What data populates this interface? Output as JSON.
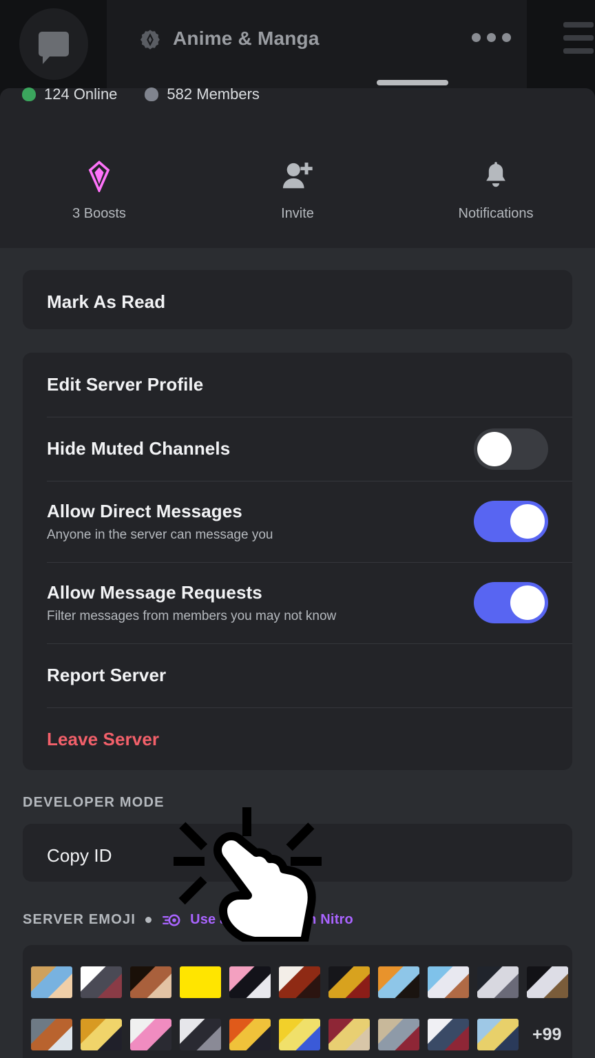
{
  "window": {
    "background_color": "#2b2d31",
    "card_color": "#232428",
    "accent_blurple": "#5865F2",
    "danger_color": "#f2606a",
    "nitro_color": "#a964ff",
    "boost_color": "#ff73fa"
  },
  "chrome": {
    "chat_icon": "chat-bubble-icon",
    "server_badge_icon": "server-verified-badge-icon",
    "title": "Anime & Manga",
    "overflow_icon": "more-options-icon",
    "drag_handle": "sheet-drag-handle",
    "hamburger_icon": "hamburger-menu-icon"
  },
  "counts": {
    "online": "124 Online",
    "members": "582 Members",
    "online_dot_color": "#3ba55d",
    "members_dot_color": "#80848e"
  },
  "actions": [
    {
      "label": "3 Boosts",
      "icon": "boost-gem-icon"
    },
    {
      "label": "Invite",
      "icon": "person-add-icon"
    },
    {
      "label": "Notifications",
      "icon": "bell-icon"
    }
  ],
  "mark_as_read": {
    "label": "Mark As Read"
  },
  "settings_rows": [
    {
      "title": "Edit Server Profile",
      "subtitle": "",
      "control": "none",
      "danger": false
    },
    {
      "title": "Hide Muted Channels",
      "subtitle": "",
      "control": "toggle-off",
      "danger": false
    },
    {
      "title": "Allow Direct Messages",
      "subtitle": "Anyone in the server can message you",
      "control": "toggle-on",
      "danger": false
    },
    {
      "title": "Allow Message Requests",
      "subtitle": "Filter messages from members you may not know",
      "control": "toggle-on",
      "danger": false
    },
    {
      "title": "Report Server",
      "subtitle": "",
      "control": "none",
      "danger": false
    },
    {
      "title": "Leave Server",
      "subtitle": "",
      "control": "none",
      "danger": true
    }
  ],
  "developer_mode": {
    "section_label": "DEVELOPER MODE",
    "copy_id_label": "Copy ID"
  },
  "server_emoji": {
    "section_label": "SERVER EMOJI",
    "nitro_icon": "nitro-boost-icon",
    "nitro_label": "Use anywhere with Nitro",
    "more_count": "+99",
    "row1": [
      {
        "name": "naruto-squint-emoji",
        "c1": "#cfa15c",
        "c2": "#78b2e0",
        "c3": "#f0cfa8"
      },
      {
        "name": "itachi-facepalm-emoji",
        "c1": "#ffffff",
        "c2": "#4a4a55",
        "c3": "#8a3b46"
      },
      {
        "name": "dark-scream-emoji",
        "c1": "#1a1008",
        "c2": "#a9603c",
        "c3": "#e3c3a4"
      },
      {
        "name": "koro-sensei-grin-emoji",
        "c1": "#ffe500",
        "c2": "#ffe500",
        "c3": "#ffe500"
      },
      {
        "name": "pink-koro-sensei-emoji",
        "c1": "#f3a0c0",
        "c2": "#13131a",
        "c3": "#e8e8ee"
      },
      {
        "name": "red-hair-emoji",
        "c1": "#f3eee8",
        "c2": "#8f2a14",
        "c3": "#2b1410"
      },
      {
        "name": "yellow-whip-emoji",
        "c1": "#16161a",
        "c2": "#d8a21e",
        "c3": "#8b1d18"
      },
      {
        "name": "orange-sky-emoji",
        "c1": "#e8932c",
        "c2": "#8ec6e8",
        "c3": "#1a1410"
      },
      {
        "name": "blue-sky-emoji",
        "c1": "#7fc2ea",
        "c2": "#e8e8f0",
        "c3": "#b06a45"
      },
      {
        "name": "asta-shout-emoji",
        "c1": "#20242c",
        "c2": "#d8d8e0",
        "c3": "#6a6a78"
      },
      {
        "name": "asta-dark-emoji",
        "c1": "#121216",
        "c2": "#ddddE6",
        "c3": "#7a5c3a"
      }
    ],
    "row2": [
      {
        "name": "grey-fight-emoji",
        "c1": "#6e7a85",
        "c2": "#b9632e",
        "c3": "#dde4ea"
      },
      {
        "name": "naruto-ramen-emoji",
        "c1": "#d89a22",
        "c2": "#f0d46a",
        "c3": "#20202a"
      },
      {
        "name": "pink-hair-wave-emoji",
        "c1": "#f0f0f0",
        "c2": "#f08cc0",
        "c3": "#2a2a32"
      },
      {
        "name": "ichigo-bw-emoji",
        "c1": "#e6e6ea",
        "c2": "#2a2a32",
        "c3": "#8a8a96"
      },
      {
        "name": "ichigo-orange-emoji",
        "c1": "#e05a1a",
        "c2": "#f0c23a",
        "c3": "#20202a"
      },
      {
        "name": "goku-super-saiyan-emoji",
        "c1": "#f2d02a",
        "c2": "#f0e06a",
        "c3": "#3a5ad8"
      },
      {
        "name": "edward-elric-emoji",
        "c1": "#8e2636",
        "c2": "#e8cf72",
        "c3": "#d8c6a8"
      },
      {
        "name": "elric-brothers-emoji",
        "c1": "#c8b89a",
        "c2": "#8e9aa8",
        "c3": "#8e2636"
      },
      {
        "name": "alchemy-circle-emoji",
        "c1": "#f0f0f4",
        "c2": "#3a4a66",
        "c3": "#8e2636"
      },
      {
        "name": "family-photo-emoji",
        "c1": "#9ec8e6",
        "c2": "#e8d06a",
        "c3": "#2a3a5a"
      }
    ]
  },
  "cursor": {
    "icon": "click-hand-cursor"
  }
}
